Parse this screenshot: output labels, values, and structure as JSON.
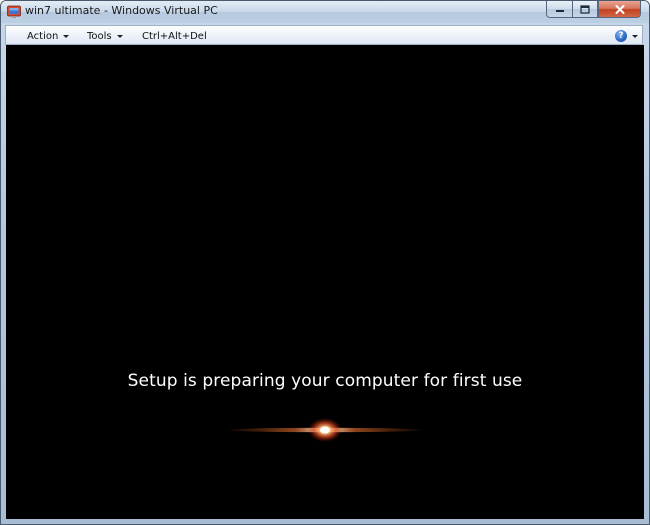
{
  "window": {
    "title": "win7 ultimate - Windows Virtual PC",
    "app_icon": "virtual-pc-icon",
    "caption_buttons": [
      "minimize",
      "maximize",
      "close"
    ]
  },
  "menubar": {
    "items": [
      {
        "label": "Action",
        "has_dropdown": true
      },
      {
        "label": "Tools",
        "has_dropdown": true
      },
      {
        "label": "Ctrl+Alt+Del",
        "has_dropdown": false
      }
    ],
    "help_icon": "help-icon"
  },
  "vm_screen": {
    "status_text": "Setup is preparing your computer for first use",
    "animation": "windows-boot-glow"
  },
  "colors": {
    "screen_background": "#000000",
    "status_text": "#ffffff",
    "glow_core": "#ff7a30"
  }
}
